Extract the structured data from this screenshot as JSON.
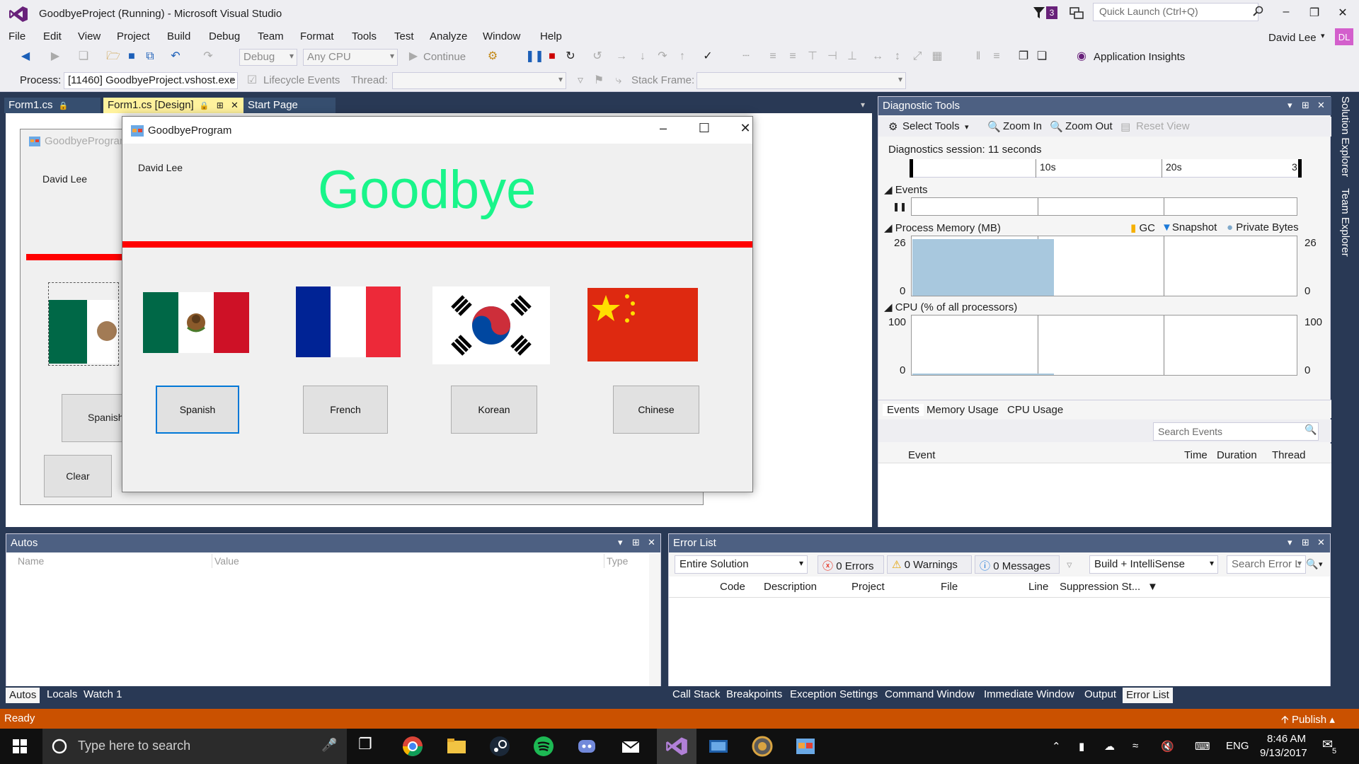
{
  "window": {
    "title": "GoodbyeProject (Running) - Microsoft Visual Studio",
    "notification_count": "3",
    "quick_launch_placeholder": "Quick Launch (Ctrl+Q)",
    "user": "David Lee",
    "avatar_initials": "DL"
  },
  "menu": [
    "File",
    "Edit",
    "View",
    "Project",
    "Build",
    "Debug",
    "Team",
    "Format",
    "Tools",
    "Test",
    "Analyze",
    "Window",
    "Help"
  ],
  "toolbar": {
    "config": "Debug",
    "platform": "Any CPU",
    "continue_label": "Continue",
    "app_insights": "Application Insights",
    "process_label": "Process:",
    "process_value": "[11460] GoodbyeProject.vshost.exe",
    "lifecycle": "Lifecycle Events",
    "thread_label": "Thread:",
    "stackframe_label": "Stack Frame:"
  },
  "doc_tabs": [
    {
      "label": "Form1.cs"
    },
    {
      "label": "Form1.cs [Design]"
    },
    {
      "label": "Start Page"
    }
  ],
  "design_form": {
    "title": "GoodbyeProgram",
    "name": "David Lee",
    "button1": "Spanish",
    "button2": "Clear"
  },
  "run_form": {
    "title": "GoodbyeProgram",
    "name_label": "David Lee",
    "heading": "Goodbye",
    "heading_color": "#19f58a",
    "buttons": [
      "Spanish",
      "French",
      "Korean",
      "Chinese"
    ]
  },
  "diagnostics": {
    "title": "Diagnostic Tools",
    "select_tools": "Select Tools",
    "zoom_in": "Zoom In",
    "zoom_out": "Zoom Out",
    "reset_view": "Reset View",
    "session": "Diagnostics session: 11 seconds",
    "ruler_ticks": [
      "10s",
      "20s",
      "3"
    ],
    "events_label": "Events",
    "memory_label": "Process Memory (MB)",
    "legend": [
      "GC",
      "Snapshot",
      "Private Bytes"
    ],
    "memory_max": "26",
    "memory_min": "0",
    "cpu_label": "CPU (% of all processors)",
    "cpu_max": "100",
    "cpu_min": "0",
    "tabs": [
      "Events",
      "Memory Usage",
      "CPU Usage"
    ],
    "search_placeholder": "Search Events",
    "columns": [
      "Event",
      "Time",
      "Duration",
      "Thread"
    ]
  },
  "side_tabs": [
    "Solution Explorer",
    "Team Explorer"
  ],
  "autos": {
    "title": "Autos",
    "columns": [
      "Name",
      "Value",
      "Type"
    ],
    "tabs": [
      "Autos",
      "Locals",
      "Watch 1"
    ]
  },
  "error_list": {
    "title": "Error List",
    "scope": "Entire Solution",
    "errors": "0 Errors",
    "warnings": "0 Warnings",
    "messages": "0 Messages",
    "build_filter": "Build + IntelliSense",
    "search_placeholder": "Search Error L",
    "columns": [
      "Code",
      "Description",
      "Project",
      "File",
      "Line",
      "Suppression St..."
    ],
    "tabs": [
      "Call Stack",
      "Breakpoints",
      "Exception Settings",
      "Command Window",
      "Immediate Window",
      "Output",
      "Error List"
    ]
  },
  "status": {
    "text": "Ready",
    "publish": "Publish"
  },
  "taskbar": {
    "search_placeholder": "Type here to search",
    "language": "ENG",
    "time": "8:46 AM",
    "date": "9/13/2017",
    "notifications": "5"
  },
  "colors": {
    "vs_purple": "#68217a",
    "status_orange": "#ca5100",
    "panel_header": "#4d6082",
    "active_tab": "#fff29d"
  }
}
